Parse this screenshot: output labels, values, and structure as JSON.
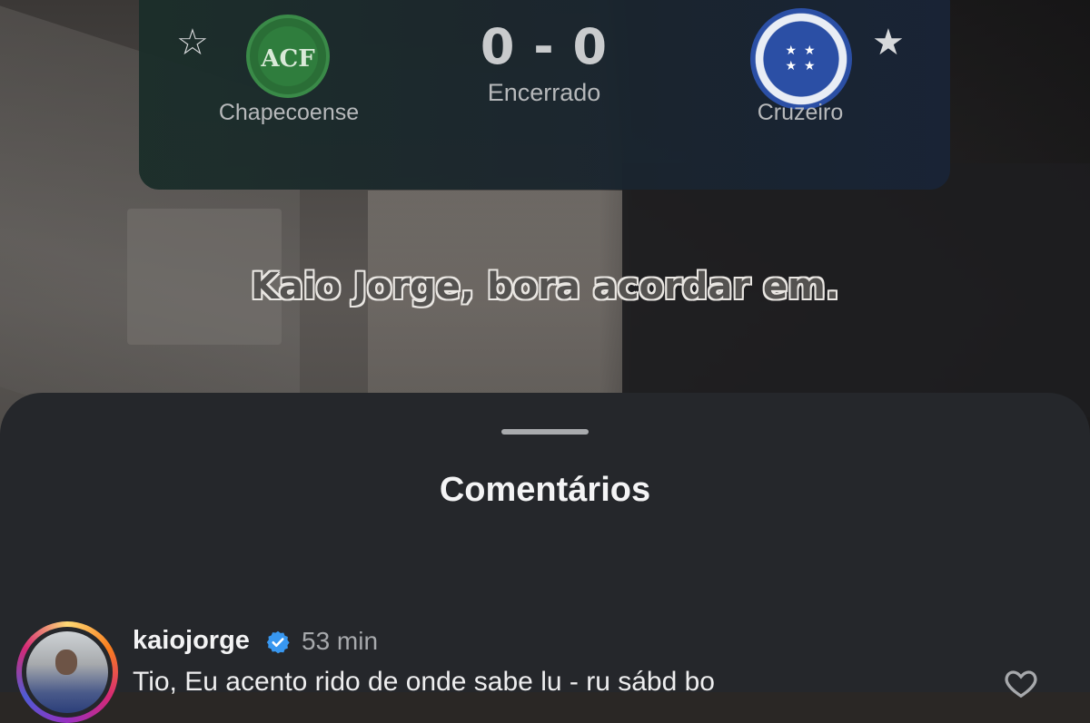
{
  "scorecard": {
    "home_team": "Chapecoense",
    "away_team": "Cruzeiro",
    "home_logo_text": "ACF",
    "score": "0 - 0",
    "status": "Encerrado",
    "favorite_icon_home": "star-outline-icon",
    "favorite_icon_away": "star-filled-icon"
  },
  "caption": "Kaio Jorge, bora acordar em.",
  "comments_sheet": {
    "title": "Comentários",
    "comments": [
      {
        "username": "kaiojorge",
        "verified": true,
        "time": "53 min",
        "text": "Tio, Eu acento rido de onde sabe lu - ru sábd bo",
        "like_icon": "heart-icon"
      }
    ]
  },
  "colors": {
    "sheet_bg": "#25272b",
    "verified_blue": "#3897f0"
  }
}
